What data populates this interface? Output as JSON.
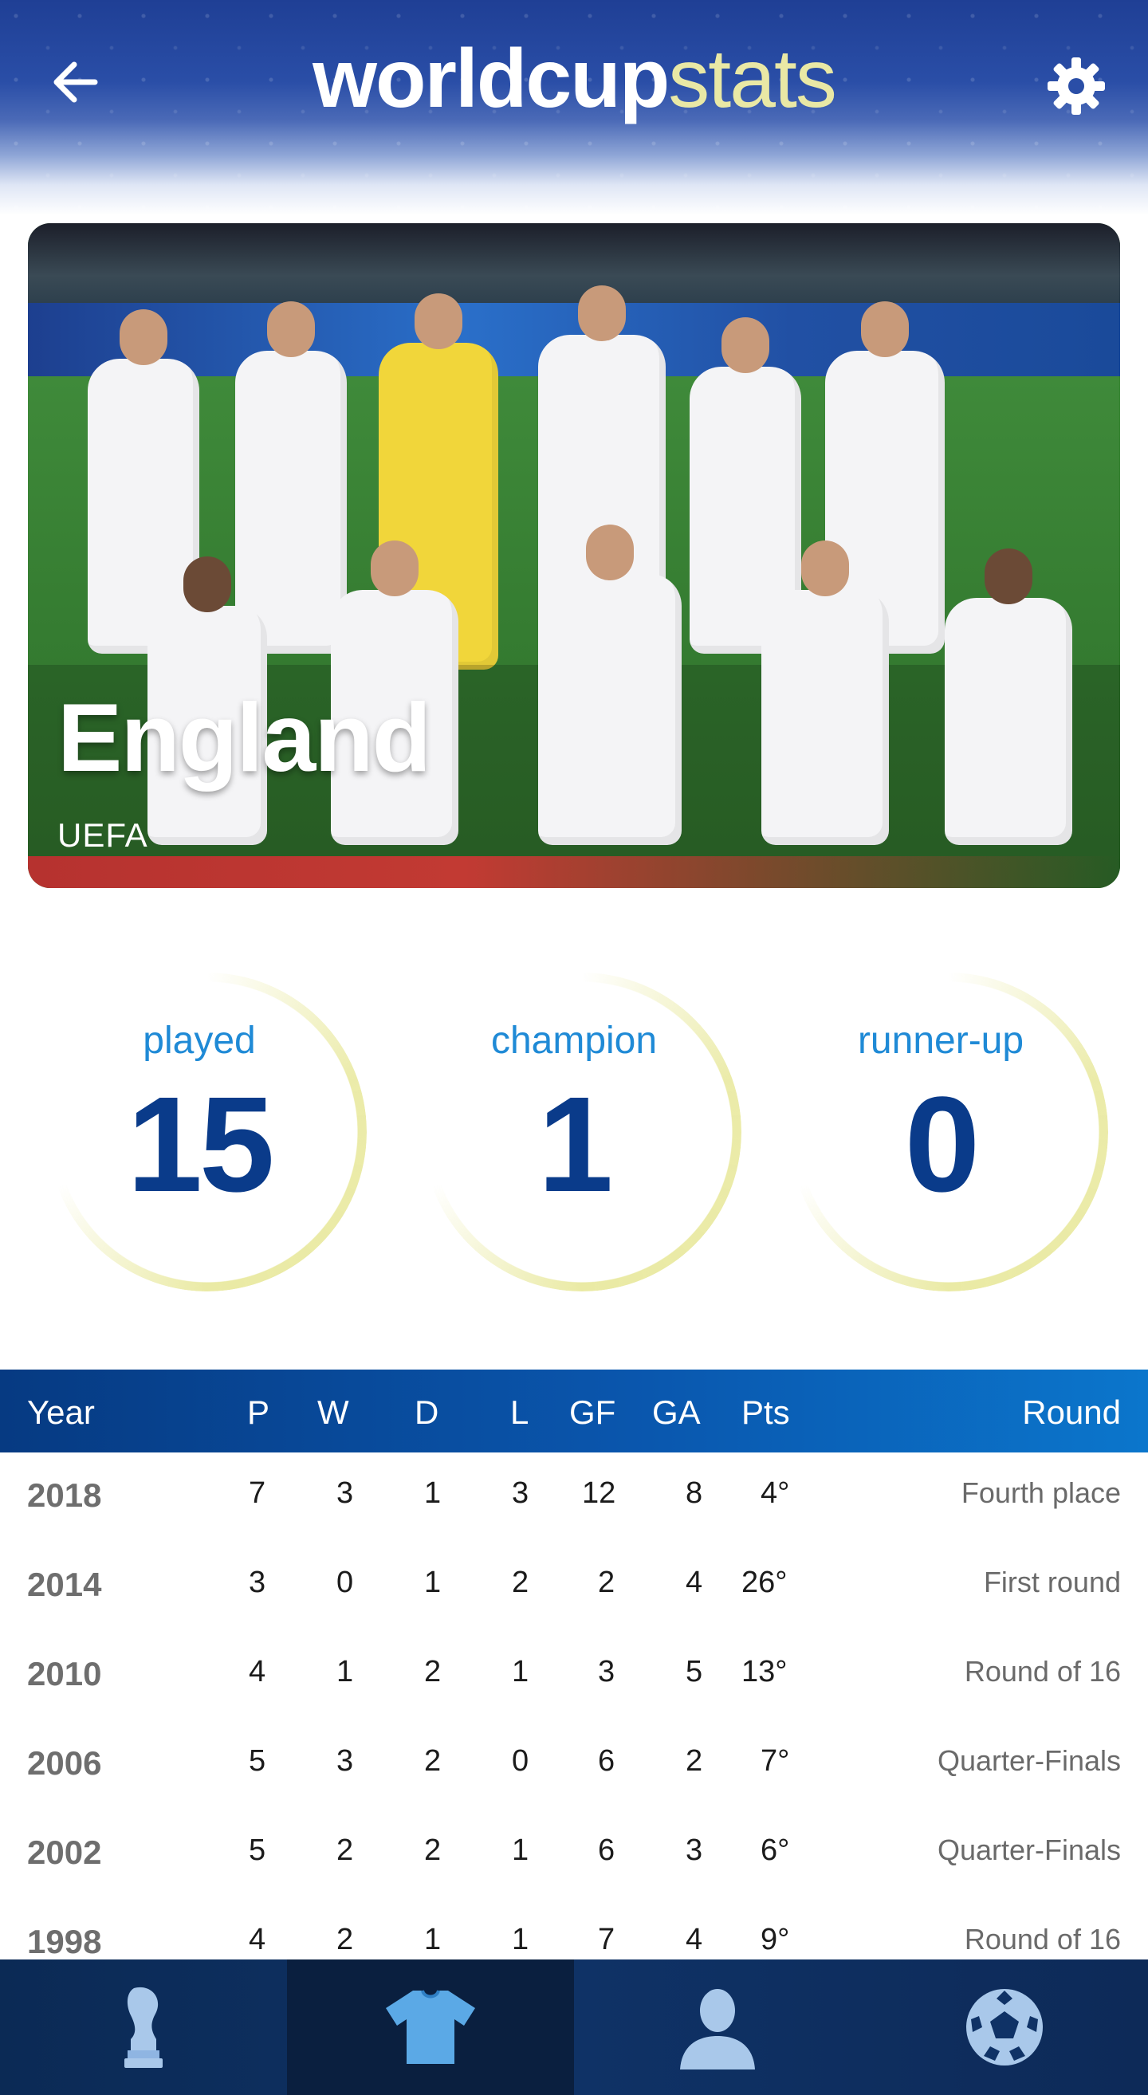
{
  "header": {
    "logo_world": "worldcup",
    "logo_stats": "stats",
    "back_icon": "arrow-left-icon",
    "settings_icon": "gear-icon"
  },
  "team": {
    "name": "England",
    "confederation": "UEFA"
  },
  "stats": [
    {
      "label": "played",
      "value": "15"
    },
    {
      "label": "champion",
      "value": "1"
    },
    {
      "label": "runner-up",
      "value": "0"
    }
  ],
  "table": {
    "headers": [
      "Year",
      "P",
      "W",
      "D",
      "L",
      "GF",
      "GA",
      "Pts",
      "Round"
    ],
    "rows": [
      {
        "year": "2018",
        "p": "7",
        "w": "3",
        "d": "1",
        "l": "3",
        "gf": "12",
        "ga": "8",
        "pts": "4°",
        "round": "Fourth place"
      },
      {
        "year": "2014",
        "p": "3",
        "w": "0",
        "d": "1",
        "l": "2",
        "gf": "2",
        "ga": "4",
        "pts": "26°",
        "round": "First round"
      },
      {
        "year": "2010",
        "p": "4",
        "w": "1",
        "d": "2",
        "l": "1",
        "gf": "3",
        "ga": "5",
        "pts": "13°",
        "round": "Round of 16"
      },
      {
        "year": "2006",
        "p": "5",
        "w": "3",
        "d": "2",
        "l": "0",
        "gf": "6",
        "ga": "2",
        "pts": "7°",
        "round": "Quarter-Finals"
      },
      {
        "year": "2002",
        "p": "5",
        "w": "2",
        "d": "2",
        "l": "1",
        "gf": "6",
        "ga": "3",
        "pts": "6°",
        "round": "Quarter-Finals"
      },
      {
        "year": "1998",
        "p": "4",
        "w": "2",
        "d": "1",
        "l": "1",
        "gf": "7",
        "ga": "4",
        "pts": "9°",
        "round": "Round of 16"
      }
    ]
  },
  "bottom_nav": [
    {
      "icon": "trophy-icon",
      "active": false
    },
    {
      "icon": "jersey-icon",
      "active": true
    },
    {
      "icon": "player-icon",
      "active": false
    },
    {
      "icon": "football-icon",
      "active": false
    }
  ],
  "colors": {
    "primary_dark": "#0a3b8a",
    "accent_blue": "#1f8ad6",
    "logo_accent": "#e9e8a5",
    "nav_bg": "#0f3266"
  }
}
